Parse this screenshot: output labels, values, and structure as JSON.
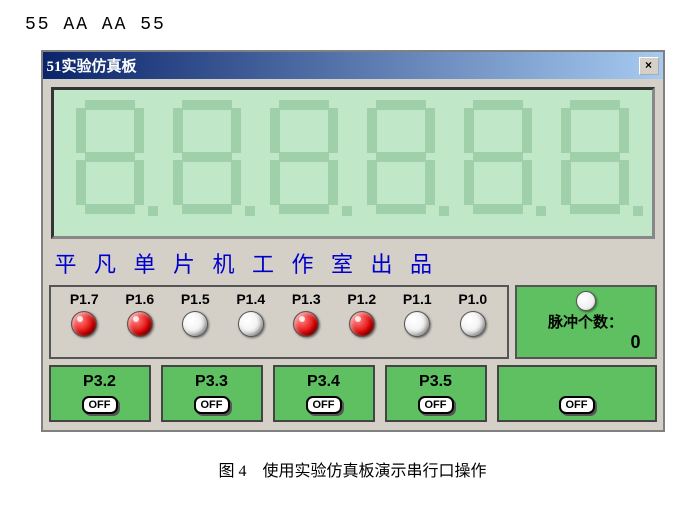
{
  "hex_line": "55  AA  AA  55",
  "window_title": "51实验仿真板",
  "subtitle": "平 凡 单 片 机 工 作 室 出 品",
  "leds": [
    {
      "label": "P1.7",
      "on": true
    },
    {
      "label": "P1.6",
      "on": true
    },
    {
      "label": "P1.5",
      "on": false
    },
    {
      "label": "P1.4",
      "on": false
    },
    {
      "label": "P1.3",
      "on": true
    },
    {
      "label": "P1.2",
      "on": true
    },
    {
      "label": "P1.1",
      "on": false
    },
    {
      "label": "P1.0",
      "on": false
    }
  ],
  "pulse": {
    "label": "脉冲个数：",
    "count": "0",
    "switch": "OFF"
  },
  "switches": [
    {
      "label": "P3.2",
      "state": "OFF"
    },
    {
      "label": "P3.3",
      "state": "OFF"
    },
    {
      "label": "P3.4",
      "state": "OFF"
    },
    {
      "label": "P3.5",
      "state": "OFF"
    }
  ],
  "caption": "图 4　使用实验仿真板演示串行口操作"
}
